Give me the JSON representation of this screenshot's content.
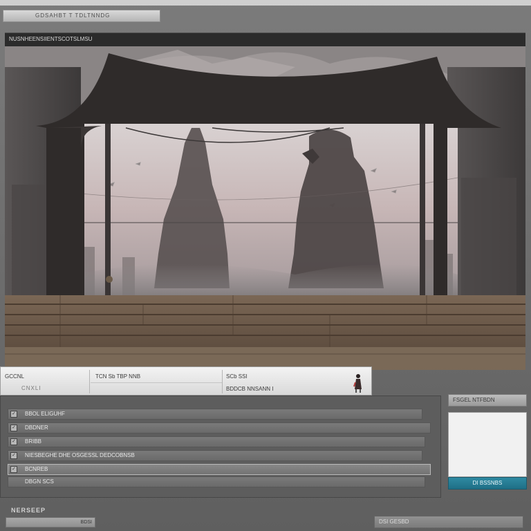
{
  "window": {
    "address_text": "GDSAHBT  T  TDLTNNDG",
    "title": "NUSNHEENSIIENTSCOTSLMSU"
  },
  "properties": {
    "field1_label": "GCCNL",
    "field1_sub": "CNXLI",
    "field2_label": "TCN Sb TBP NNB",
    "field3_label": "SCb SSI",
    "field3_value": "BDDCB NNSANN",
    "field3_value_suffix": "I"
  },
  "layers": [
    {
      "label": "BBOL ELIGUHF",
      "checked": "✓"
    },
    {
      "label": "DBDNER",
      "checked": "✓"
    },
    {
      "label": "BRIBB",
      "checked": "✓"
    },
    {
      "label": "NIESBEGHE DHE OSGESSL DEDCOBNSB",
      "checked": "✓"
    },
    {
      "label": "BCNREB",
      "checked": "✓"
    },
    {
      "label": "DBGN SCS",
      "checked": ""
    }
  ],
  "side_panel": {
    "header": "FSGEL   NTFBDN",
    "button": "DI BSSNBS"
  },
  "status": {
    "label": "NERSEEP",
    "field_value": "BDSI",
    "right_text": "DSI  GESBD"
  },
  "colors": {
    "accent": "#2a7f97",
    "title_bar": "#2b2b2b",
    "panel": "#5d5d5d"
  }
}
